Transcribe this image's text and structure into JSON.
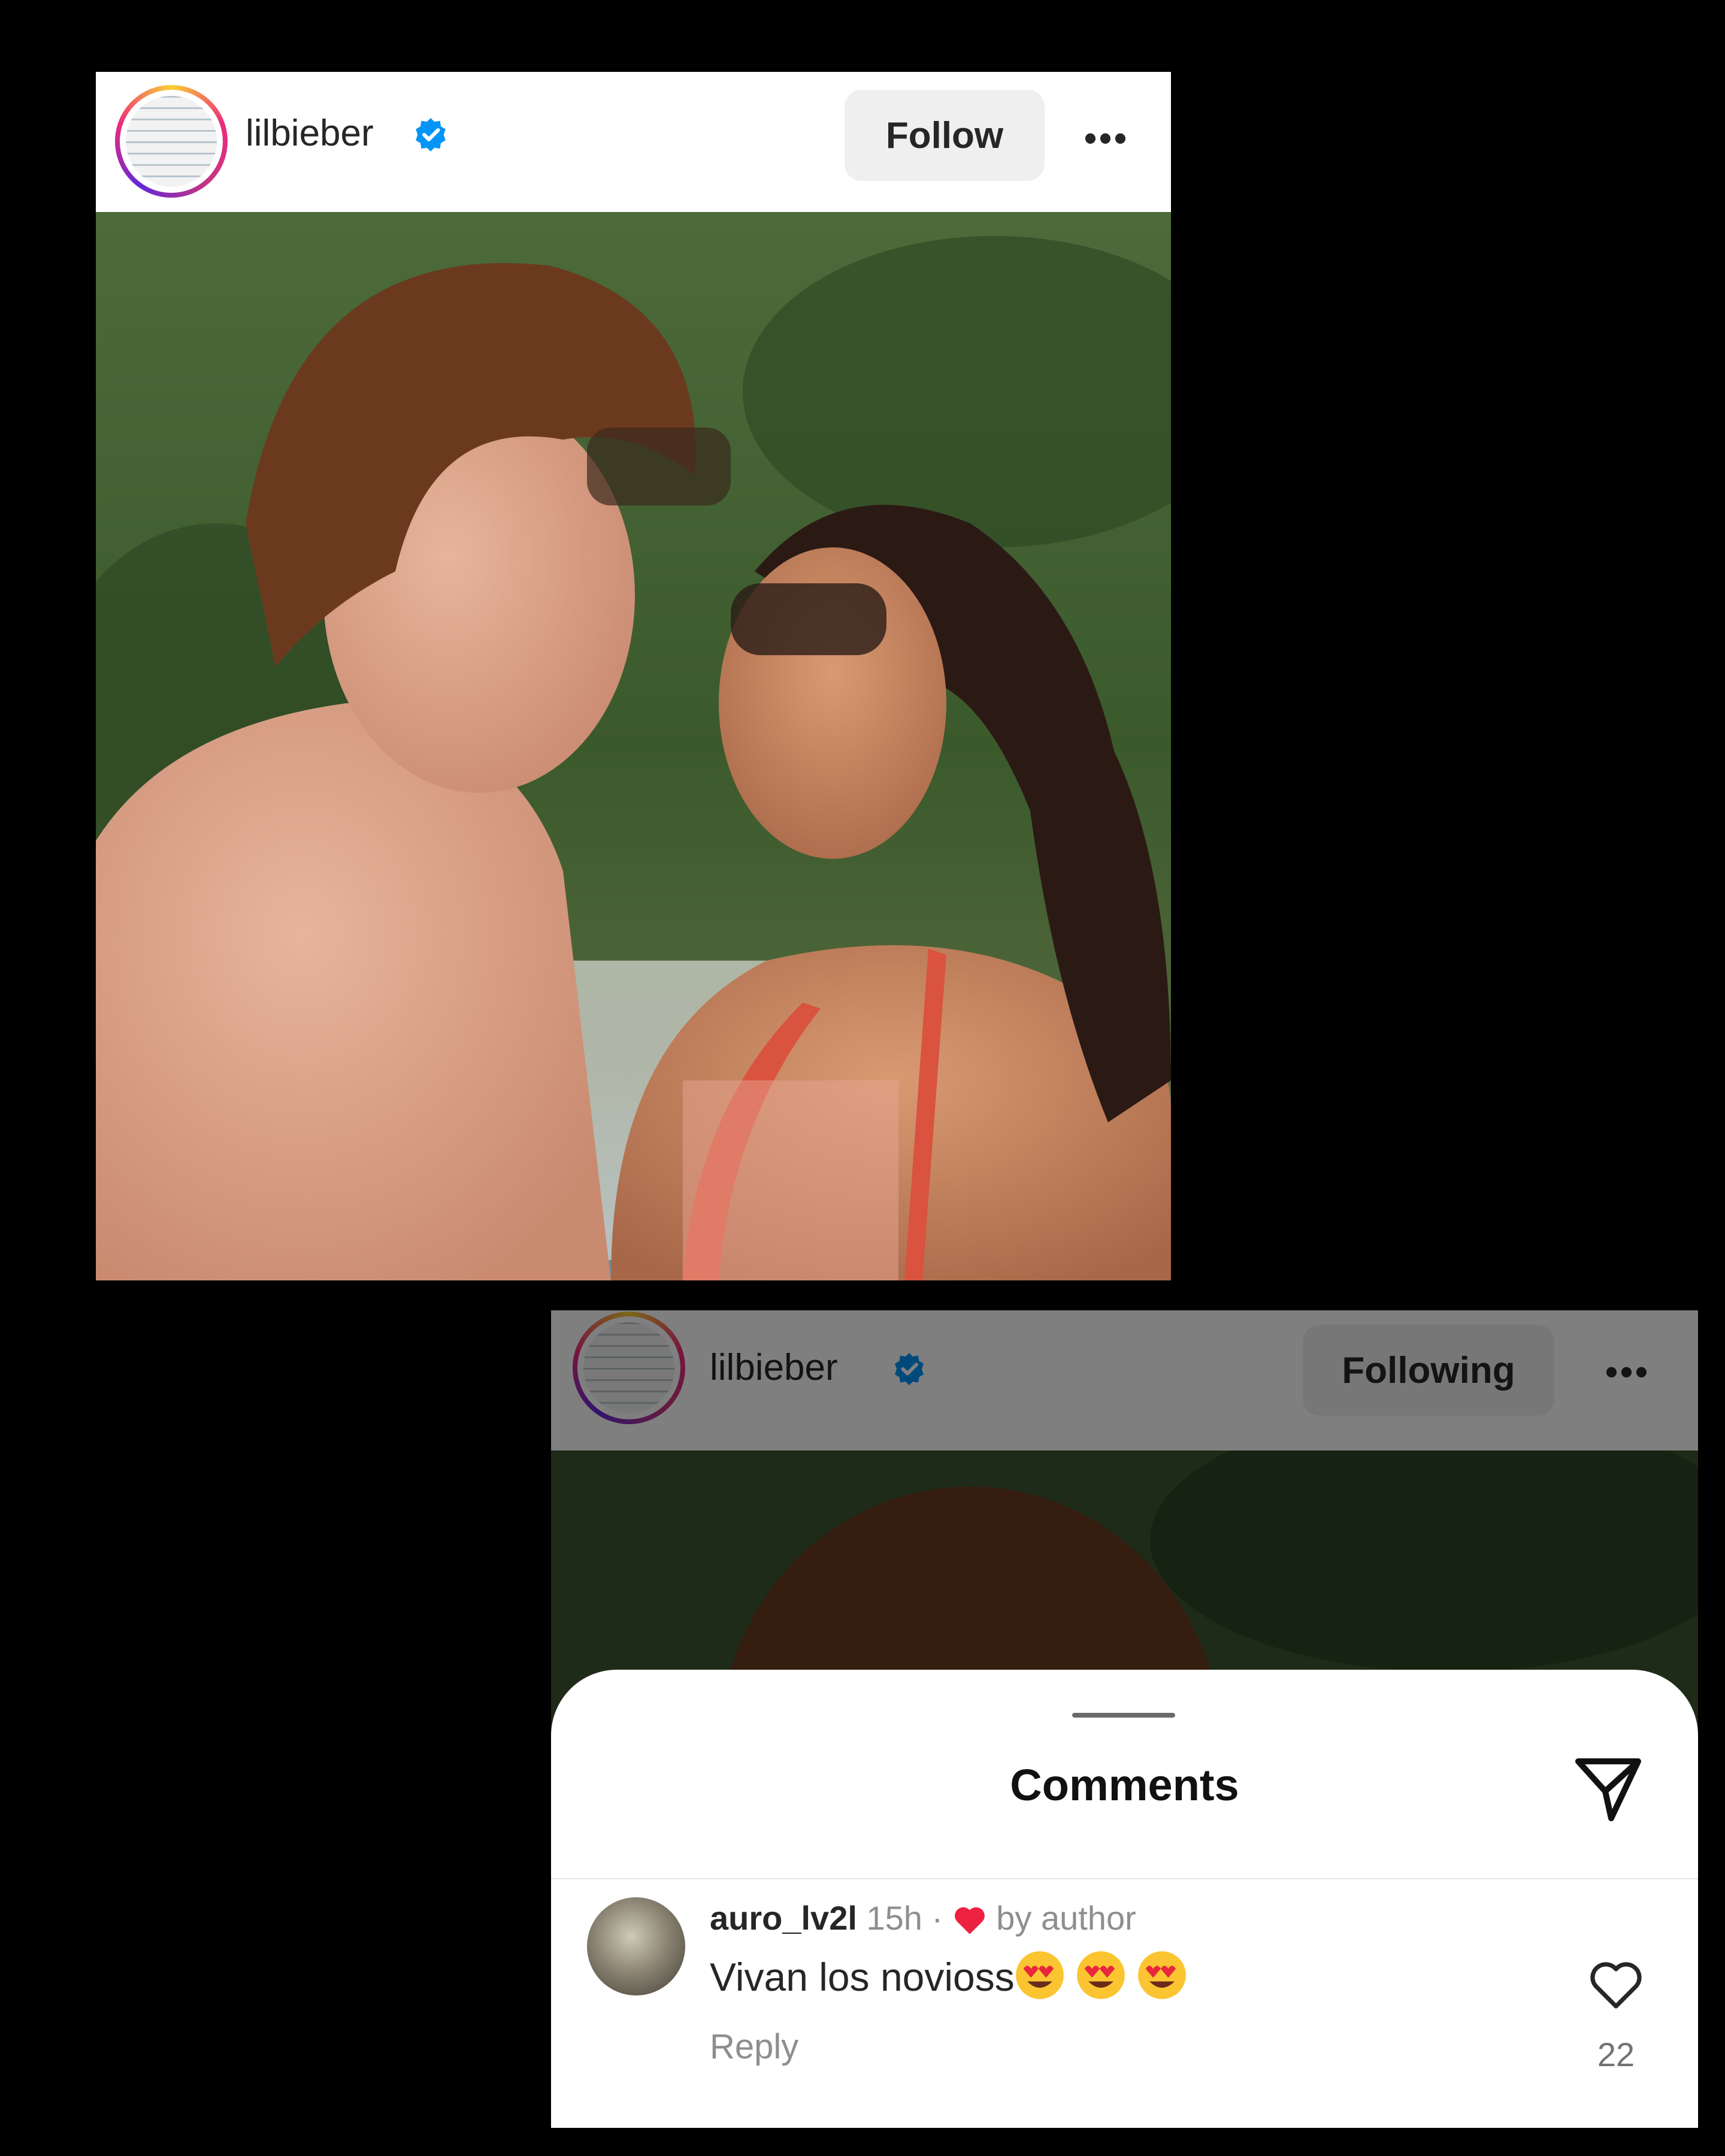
{
  "post_card": {
    "username": "lilbieber",
    "follow_label": "Follow",
    "more_label": "•••"
  },
  "comments_card": {
    "username": "lilbieber",
    "following_label": "Following",
    "more_label": "•••",
    "sheet_title": "Comments",
    "comment": {
      "user": "auro_lv2l",
      "time": "15h",
      "separator": "·",
      "liked_by": "by author",
      "text": "Vivan los novioss",
      "reply_label": "Reply",
      "like_count": "22"
    }
  },
  "colors": {
    "verified_badge": "#0095f6",
    "heart_red": "#ed4956",
    "button_bg": "#efefef",
    "text_primary": "#262626",
    "text_secondary": "#8e8e8e"
  },
  "icons": [
    "verified-badge-icon",
    "more-options-icon",
    "share-send-icon",
    "heart-outline-icon",
    "red-heart-icon",
    "heart-eyes-emoji"
  ]
}
